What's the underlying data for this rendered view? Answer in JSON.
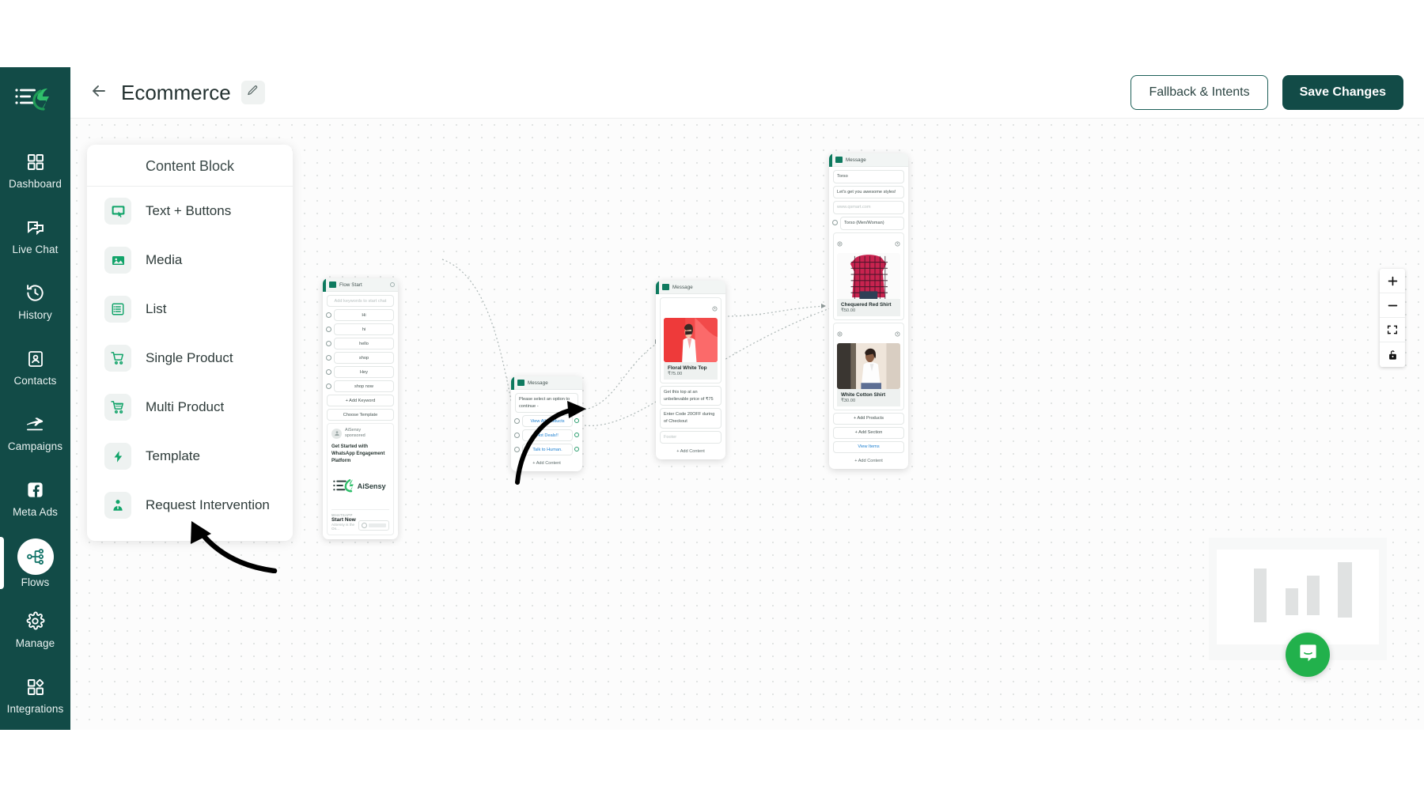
{
  "sidebar": {
    "logo_name": "aisensy-logo",
    "items": [
      {
        "label": "Dashboard",
        "icon": "dashboard-grid-icon",
        "active": false
      },
      {
        "label": "Live Chat",
        "icon": "chat-bubbles-icon",
        "active": false
      },
      {
        "label": "History",
        "icon": "clock-history-icon",
        "active": false
      },
      {
        "label": "Contacts",
        "icon": "contact-card-icon",
        "active": false
      },
      {
        "label": "Campaigns",
        "icon": "paper-plane-icon",
        "active": false
      },
      {
        "label": "Meta Ads",
        "icon": "facebook-icon",
        "active": false
      },
      {
        "label": "Flows",
        "icon": "flow-nodes-icon",
        "active": true
      },
      {
        "label": "Manage",
        "icon": "gear-icon",
        "active": false
      },
      {
        "label": "Integrations",
        "icon": "integrations-icon",
        "active": false
      }
    ]
  },
  "header": {
    "back_icon": "arrow-left-icon",
    "title": "Ecommerce",
    "edit_icon": "pencil-icon",
    "fallback_label": "Fallback & Intents",
    "save_label": "Save Changes"
  },
  "content_block": {
    "title": "Content Block",
    "items": [
      {
        "label": "Text + Buttons",
        "icon": "text-buttons-icon"
      },
      {
        "label": "Media",
        "icon": "image-icon"
      },
      {
        "label": "List",
        "icon": "list-icon"
      },
      {
        "label": "Single Product",
        "icon": "cart-icon"
      },
      {
        "label": "Multi Product",
        "icon": "multi-cart-icon"
      },
      {
        "label": "Template",
        "icon": "lightning-icon"
      },
      {
        "label": "Request Intervention",
        "icon": "agent-icon"
      }
    ]
  },
  "flow": {
    "nodes": [
      {
        "id": "flow-start",
        "title": "Flow Start",
        "keyword_placeholder": "Add keywords to start chat",
        "keywords": [
          "Hi",
          "hi",
          "hello",
          "shop",
          "Hey",
          "shop now"
        ],
        "add_keyword_label": "+ Add Keyword",
        "choose_template_label": "Choose Template",
        "template_preview": {
          "sender": "AiSensy",
          "sender_sub": "sponsored",
          "headline": "Get Started with WhatsApp Engagement Platform",
          "brand": "AiSensy",
          "footer_kicker": "WHATSAPP",
          "footer_title": "Start Now",
          "footer_sub": "AiSensy is the On..."
        }
      },
      {
        "id": "options-message",
        "title": "Message",
        "body": "Please select an option to continue -",
        "options": [
          "View All Products",
          "Hot Deals!!",
          "Talk to Human."
        ],
        "add_content_label": "+ Add Content"
      },
      {
        "id": "product-message",
        "title": "Message",
        "product_name": "Floral White Top",
        "product_price": "₹75.00",
        "body_line1": "Get this top at an unbelievable price of ₹75",
        "body_line2": "Enter Code 20OFF during of Checkout",
        "footer_placeholder": "Footer",
        "add_content_label": "+ Add Content"
      },
      {
        "id": "catalog-message",
        "title": "Message",
        "header": "Torso",
        "body": "Let's get you awesome styles!",
        "footer": "www.qsmart.com",
        "section_title": "Torso (Men/Woman)",
        "products": [
          {
            "name": "Chequered Red Shirt",
            "price": "₹50.00"
          },
          {
            "name": "White Cotton Shirt",
            "price": "₹30.00"
          }
        ],
        "add_products_label": "+ Add Products",
        "add_section_label": "+ Add Section",
        "view_items_label": "View Items",
        "add_content_label": "+ Add Content"
      }
    ]
  },
  "controls": [
    {
      "name": "zoom-in",
      "glyph": "+"
    },
    {
      "name": "zoom-out",
      "glyph": "−"
    },
    {
      "name": "fit-view",
      "glyph": "fit"
    },
    {
      "name": "lock",
      "glyph": "lock"
    }
  ],
  "minimap": {
    "name": "minimap"
  },
  "chat_widget": {
    "name": "intercom-chat-button"
  },
  "colors": {
    "sidebar_bg": "#124b47",
    "accent_green": "#0e7a5f",
    "primary_btn": "#124b47",
    "link_blue": "#1b7fd1",
    "chat_green": "#22b14c"
  }
}
